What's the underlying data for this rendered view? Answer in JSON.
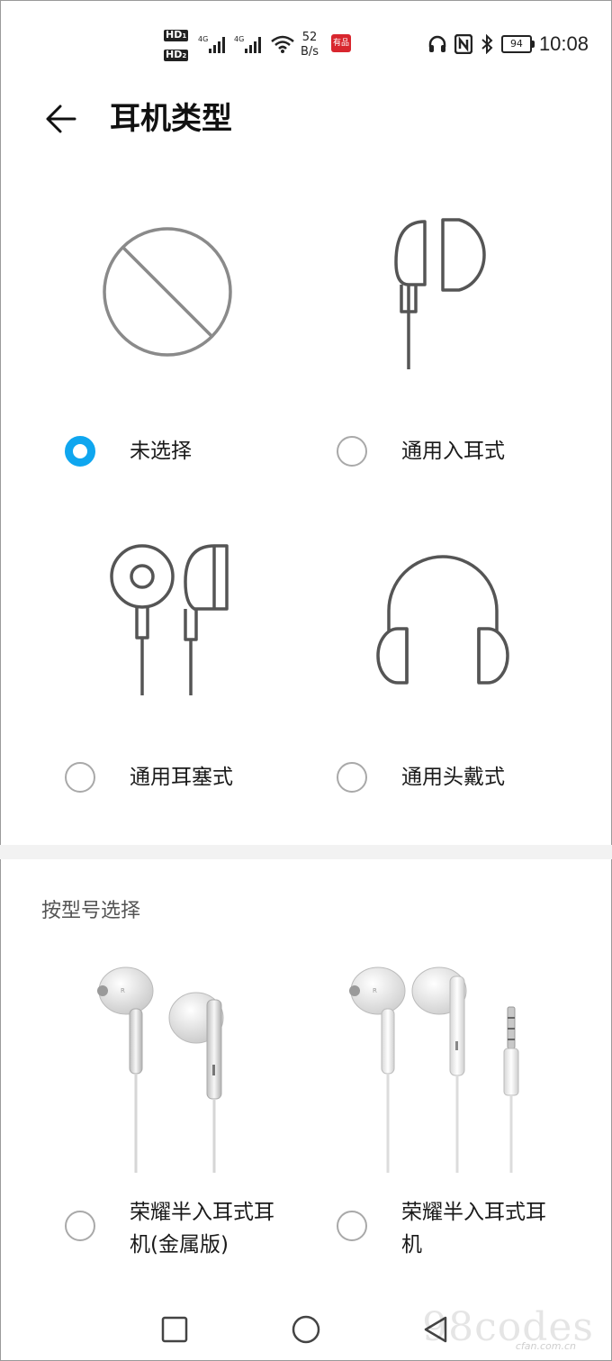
{
  "status_bar": {
    "hd1": "HD",
    "hd1_sub": "1",
    "hd2": "HD",
    "hd2_sub": "2",
    "net_type1": "4G",
    "net_type2": "4G",
    "speed_value": "52",
    "speed_unit": "B/s",
    "app_badge": "有品",
    "battery": "94",
    "time": "10:08"
  },
  "header": {
    "title": "耳机类型",
    "back_icon": "arrow-left-icon"
  },
  "options": [
    {
      "label": "未选择",
      "icon": "no-selection-icon",
      "checked": true
    },
    {
      "label": "通用入耳式",
      "icon": "in-ear-earphone-icon",
      "checked": false
    },
    {
      "label": "通用耳塞式",
      "icon": "earbud-icon",
      "checked": false
    },
    {
      "label": "通用头戴式",
      "icon": "headphones-icon",
      "checked": false
    }
  ],
  "section": {
    "title": "按型号选择"
  },
  "models": [
    {
      "label_line1": "荣耀半入耳式耳",
      "label_line2": "机(金属版)",
      "checked": false
    },
    {
      "label_line1": "荣耀半入耳式耳",
      "label_line2": "机",
      "checked": false
    }
  ],
  "navbar": {
    "recent_icon": "square-recent-icon",
    "home_icon": "circle-home-icon",
    "back_icon": "triangle-back-icon"
  },
  "watermark": {
    "text": "98codes",
    "sub": "cfan.com.cn"
  },
  "colors": {
    "accent": "#0fa6ef",
    "divider": "#f2f2f2",
    "icon_stroke": "#555555"
  }
}
